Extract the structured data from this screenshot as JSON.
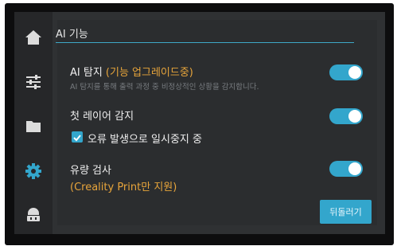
{
  "sidebar": {
    "items": [
      {
        "icon": "home-icon"
      },
      {
        "icon": "sliders-icon"
      },
      {
        "icon": "folder-icon"
      },
      {
        "icon": "gear-icon",
        "active": true
      },
      {
        "icon": "robot-icon"
      }
    ],
    "active_color": "#33a6cc"
  },
  "panel": {
    "title": "AI 기능",
    "settings": [
      {
        "label": "AI 탐지",
        "label_suffix": "(기능 업그레이드중)",
        "description": "AI 탐지를 통해 출력 과정 중 비정상적인 상황을 감지합니다.",
        "enabled": true
      },
      {
        "label": "첫 레이어 감지",
        "enabled": true,
        "option": {
          "label": "오류 발생으로 일시중지 중",
          "checked": true
        }
      },
      {
        "label": "유량 검사",
        "note": "(Creality Print만 지원)",
        "enabled": true
      }
    ],
    "back_button": "뒤돌러기"
  },
  "colors": {
    "accent": "#33a6cc",
    "warning": "#e8a53b"
  }
}
